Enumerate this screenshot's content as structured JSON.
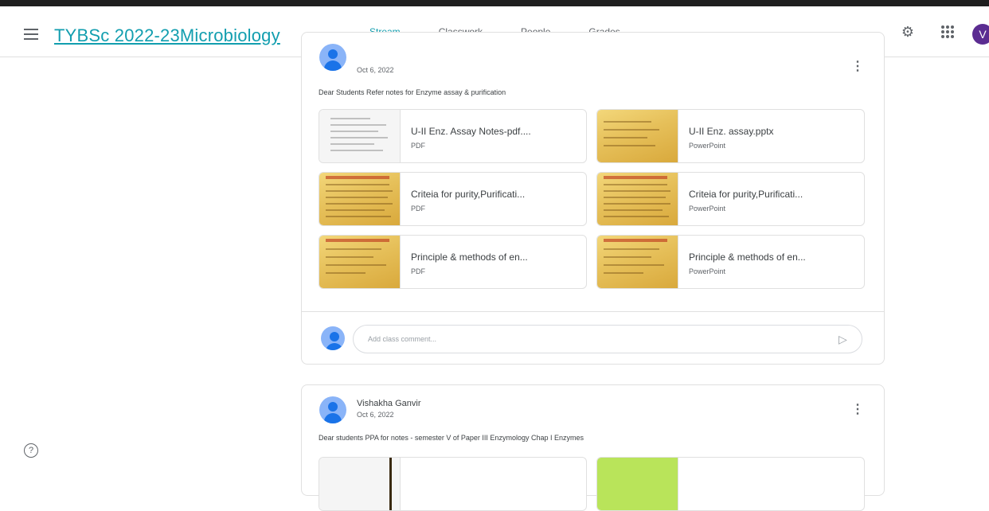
{
  "header": {
    "class_title": "TYBSc 2022-23Microbiology",
    "tabs": [
      {
        "label": "Stream",
        "active": true
      },
      {
        "label": "Classwork",
        "active": false
      },
      {
        "label": "People",
        "active": false
      },
      {
        "label": "Grades",
        "active": false
      }
    ],
    "avatar_letter": "V",
    "icons": {
      "menu": "menu-icon",
      "settings": "gear-icon",
      "apps": "apps-grid-icon",
      "help": "help-icon"
    }
  },
  "post1": {
    "date": "Oct 6, 2022",
    "text": "Dear Students Refer notes for Enzyme assay & purification",
    "attachments": [
      {
        "title": "U-II Enz. Assay Notes-pdf....",
        "type": "PDF"
      },
      {
        "title": "U-II Enz. assay.pptx",
        "type": "PowerPoint"
      },
      {
        "title": "Criteia for purity,Purificati...",
        "type": "PDF"
      },
      {
        "title": "Criteia for purity,Purificati...",
        "type": "PowerPoint"
      },
      {
        "title": "Principle & methods of en...",
        "type": "PDF"
      },
      {
        "title": "Principle & methods of en...",
        "type": "PowerPoint"
      }
    ],
    "comment_placeholder": "Add class comment..."
  },
  "post2": {
    "author": "Vishakha Ganvir",
    "date": "Oct 6, 2022",
    "text": "Dear students PPA for notes - semester V of Paper III Enzymology Chap I Enzymes"
  },
  "colors": {
    "accent": "#129eaf",
    "avatar_bg": "#5b2c91",
    "link": "#1a73e8"
  }
}
